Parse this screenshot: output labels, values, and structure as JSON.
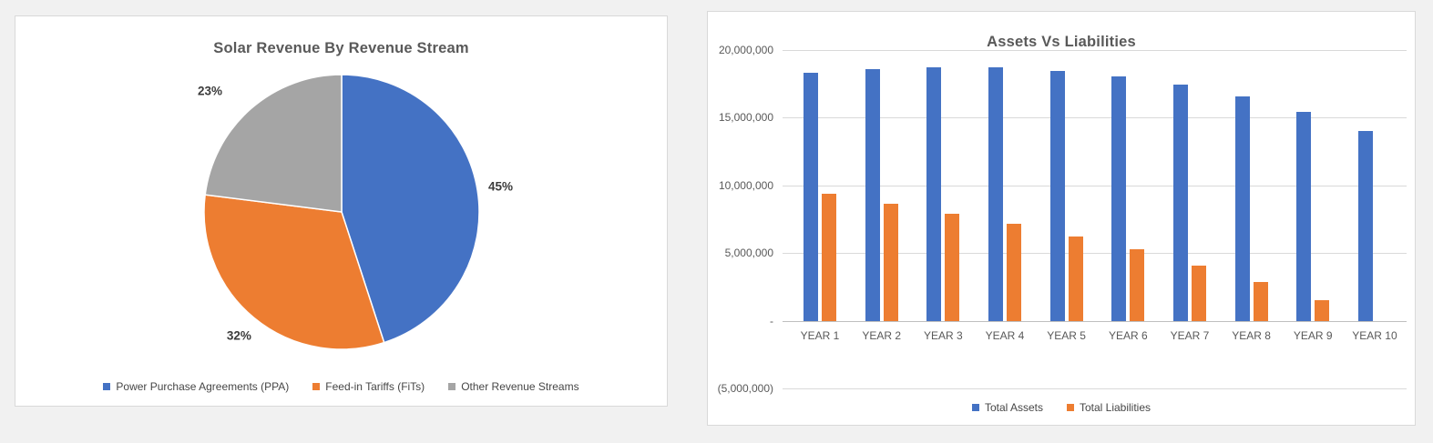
{
  "page": {
    "background": "#f1f1f1"
  },
  "theme": {
    "title_color": "#595959",
    "axis_text_color": "#595959",
    "legend_text_color": "#464646",
    "data_label_color": "#3b3b3b",
    "grid_color": "#d9d9d9",
    "axis_line_color": "#bfbfbf",
    "card_background": "#ffffff",
    "card_border": "#d9d9d9"
  },
  "chart_data": [
    {
      "type": "pie",
      "title": "Solar Revenue By Revenue Stream",
      "direction": "clockwise",
      "start_angle_deg": 0,
      "legend_position": "bottom",
      "slices": [
        {
          "label": "Power Purchase Agreements (PPA)",
          "value_pct": 45,
          "data_label": "45%",
          "color": "#4472C4"
        },
        {
          "label": "Feed-in Tariffs (FiTs)",
          "value_pct": 32,
          "data_label": "32%",
          "color": "#ED7D31"
        },
        {
          "label": "Other Revenue Streams",
          "value_pct": 23,
          "data_label": "23%",
          "color": "#A5A5A5"
        }
      ]
    },
    {
      "type": "bar",
      "title": "Assets Vs Liabilities",
      "categories": [
        "YEAR 1",
        "YEAR 2",
        "YEAR 3",
        "YEAR 4",
        "YEAR 5",
        "YEAR 6",
        "YEAR 7",
        "YEAR 8",
        "YEAR 9",
        "YEAR 10"
      ],
      "series": [
        {
          "name": "Total Assets",
          "color": "#4472C4",
          "values": [
            18350000,
            18600000,
            18750000,
            18700000,
            18450000,
            18050000,
            17450000,
            16600000,
            15450000,
            14050000
          ]
        },
        {
          "name": "Total Liabilities",
          "color": "#ED7D31",
          "values": [
            9350000,
            8650000,
            7900000,
            7150000,
            6250000,
            5300000,
            4100000,
            2850000,
            1500000,
            0
          ]
        }
      ],
      "ylim": [
        -5000000,
        20000000
      ],
      "ytick_interval": 5000000,
      "yticks": [
        {
          "value": 20000000,
          "label": "20,000,000"
        },
        {
          "value": 15000000,
          "label": "15,000,000"
        },
        {
          "value": 10000000,
          "label": "10,000,000"
        },
        {
          "value": 5000000,
          "label": "5,000,000"
        },
        {
          "value": 0,
          "label": "-"
        },
        {
          "value": -5000000,
          "label": "(5,000,000)"
        }
      ],
      "grid": "horizontal",
      "legend_position": "bottom"
    }
  ]
}
